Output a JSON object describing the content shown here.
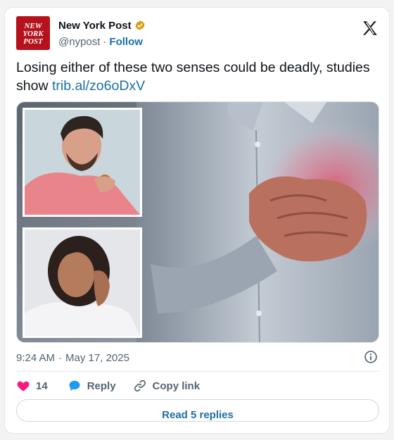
{
  "tweet": {
    "author": {
      "name": "New York Post",
      "handle": "@nypost",
      "separator": "·",
      "follow_label": "Follow",
      "logo_text": "NEW YORK POST",
      "verified": true
    },
    "text": "Losing either of these two senses could be deadly, studies show",
    "link_text": "trib.al/zo6oDxV",
    "time": "9:24 AM",
    "date_separator": "·",
    "date": "May 17, 2025",
    "likes_count": "14",
    "reply_label": "Reply",
    "copy_link_label": "Copy link",
    "read_replies_label": "Read 5 replies"
  },
  "colors": {
    "accent": "#1d6fa3",
    "like": "#f91880",
    "brand_red": "#b5121b",
    "verified_gold": "#d4a017",
    "secondary_text": "#536471"
  },
  "icons": {
    "verified": "verified-badge-icon",
    "platform": "x-logo-icon",
    "info": "info-icon",
    "like": "heart-icon",
    "reply": "speech-bubble-icon",
    "copy_link": "link-icon"
  }
}
